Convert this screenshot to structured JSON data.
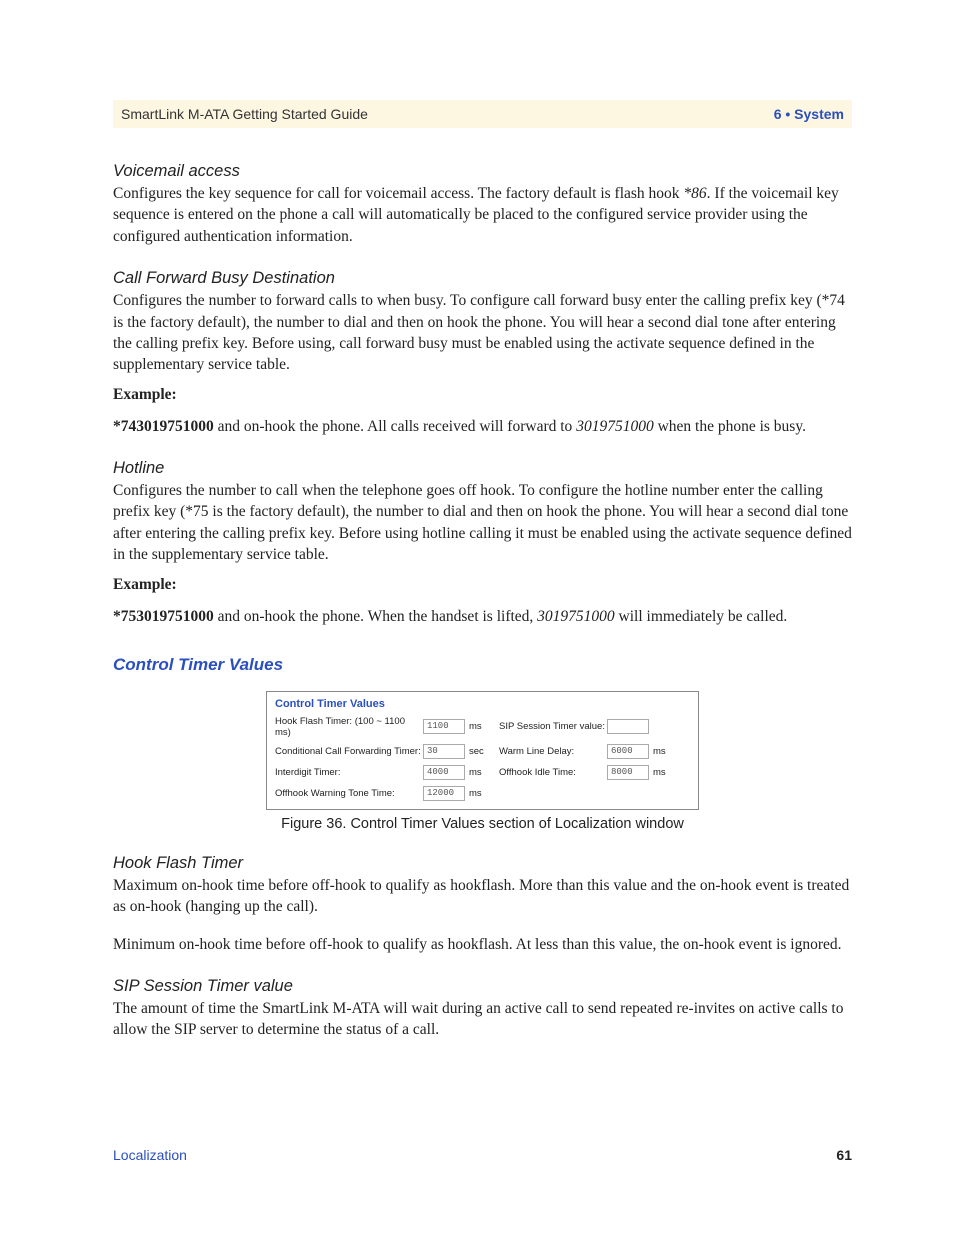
{
  "header": {
    "left": "SmartLink M-ATA Getting Started Guide",
    "right": "6 • System"
  },
  "sections": {
    "voicemail": {
      "heading": "Voicemail access",
      "para_pre": "Configures the key sequence for call for voicemail access. The factory default is flash hook ",
      "para_code": "*86",
      "para_post": ". If the voicemail key sequence is entered on the phone a call will automatically be placed to the configured service provider using the configured authentication information."
    },
    "cfwd": {
      "heading": "Call Forward Busy Destination",
      "para": "Configures the number to forward calls to when busy. To configure call forward busy enter the calling prefix key (*74 is the factory default), the number to dial and then on hook the phone. You will hear a second dial tone after entering the calling prefix key. Before using, call forward busy must be enabled using the activate sequence defined in the supplementary service table.",
      "example_label": "Example:",
      "ex_bold": "*743019751000",
      "ex_mid": " and on-hook the phone. All calls received will forward to ",
      "ex_ital": "3019751000",
      "ex_tail": " when the phone is busy."
    },
    "hotline": {
      "heading": "Hotline",
      "para": "Configures the number to call when the telephone goes off hook. To configure the hotline number enter the calling prefix key (*75 is the factory default), the number to dial and then on hook the phone. You will hear a second dial tone after entering the calling prefix key. Before using hotline calling it must be enabled using the activate sequence defined in the supplementary service table.",
      "example_label": "Example:",
      "ex_bold": "*753019751000",
      "ex_mid": " and on-hook the phone. When the handset is lifted, ",
      "ex_ital": "3019751000",
      "ex_tail": " will immediately be called."
    },
    "ctv": {
      "heading": "Control Timer Values",
      "box_title": "Control Timer Values",
      "rows": [
        {
          "l_label": "Hook Flash Timer: (100 ~ 1100 ms)",
          "l_val": "1100",
          "l_unit": "ms",
          "r_label": "SIP Session Timer value:",
          "r_val": "",
          "r_unit": ""
        },
        {
          "l_label": "Conditional Call Forwarding Timer:",
          "l_val": "30",
          "l_unit": "sec",
          "r_label": "Warm Line Delay:",
          "r_val": "6000",
          "r_unit": "ms"
        },
        {
          "l_label": "Interdigit Timer:",
          "l_val": "4000",
          "l_unit": "ms",
          "r_label": "Offhook Idle Time:",
          "r_val": "8000",
          "r_unit": "ms"
        },
        {
          "l_label": "Offhook Warning Tone Time:",
          "l_val": "12000",
          "l_unit": "ms",
          "r_label": "",
          "r_val": "",
          "r_unit": ""
        }
      ],
      "caption": "Figure 36. Control Timer Values section of Localization window"
    },
    "hookflash": {
      "heading": "Hook Flash Timer",
      "para1": "Maximum on-hook time before off-hook to qualify as hookflash. More than this value and the on-hook event is treated as on-hook (hanging up the call).",
      "para2": "Minimum on-hook time before off-hook to qualify as hookflash. At less than this value, the on-hook event is ignored."
    },
    "sip": {
      "heading": "SIP Session Timer value",
      "para": "The amount of time the SmartLink M-ATA will wait during an active call to send repeated re-invites on active calls to allow the SIP server to determine the status of a call."
    }
  },
  "footer": {
    "left": "Localization",
    "right": "61"
  }
}
